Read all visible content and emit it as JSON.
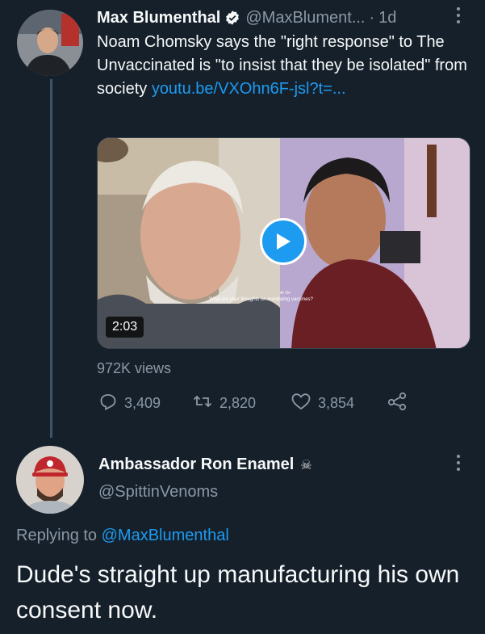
{
  "colors": {
    "background": "#15202b",
    "text_primary": "#f7f9f9",
    "text_secondary": "#8b98a5",
    "link": "#1d9bf0",
    "thread_line": "#3d5466"
  },
  "quoted_tweet": {
    "author_name": "Max Blumenthal",
    "verified_icon": "verified-badge-icon",
    "handle": "@MaxBlument...",
    "separator": "·",
    "time": "1d",
    "more_icon": "more-vertical-icon",
    "text": "Noam Chomsky says the \"right response\" to The Unvaccinated is \"to insist that they be isolated\" from society ",
    "link_text": "youtu.be/VXOhn6F-jsl?t=...",
    "video": {
      "duration": "2:03",
      "caption_name": "Ar On",
      "caption_text": "What are your thoughts on mandating vaccines?",
      "play_icon": "play-icon"
    },
    "views": "972K views",
    "metrics": {
      "replies": "3,409",
      "retweets": "2,820",
      "likes": "3,854"
    }
  },
  "reply_tweet": {
    "author_name": "Ambassador Ron Enamel",
    "name_emoji": "☠",
    "handle": "@SpittinVenoms",
    "more_icon": "more-vertical-icon",
    "replying_prefix": "Replying to ",
    "replying_handle": "@MaxBlumenthal",
    "text": "Dude's straight up manufacturing his own consent now."
  }
}
